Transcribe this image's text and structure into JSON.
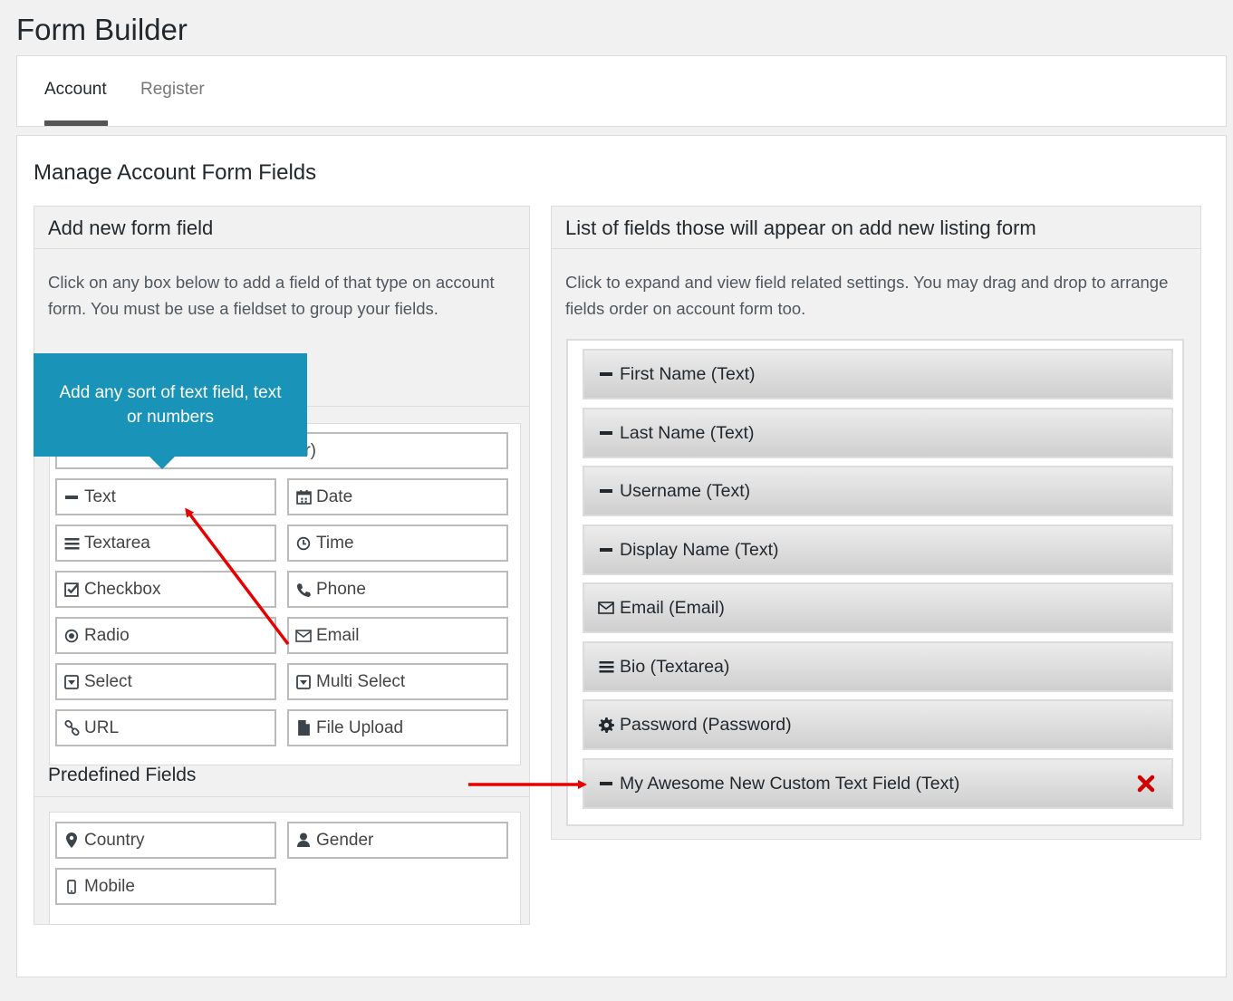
{
  "page": {
    "title": "Form Builder"
  },
  "tabs": [
    {
      "label": "Account",
      "active": true
    },
    {
      "label": "Register",
      "active": false
    }
  ],
  "section": {
    "title": "Manage Account Form Fields"
  },
  "left_panel": {
    "title": "Add new form field",
    "description": "Click on any box below to add a field of that type on account form. You must be use a fieldset to group your fields.",
    "hidden_button_partial": "r)",
    "fields": [
      {
        "label": "Text",
        "icon": "minus-icon"
      },
      {
        "label": "Date",
        "icon": "calendar-icon"
      },
      {
        "label": "Textarea",
        "icon": "bars-icon"
      },
      {
        "label": "Time",
        "icon": "clock-icon"
      },
      {
        "label": "Checkbox",
        "icon": "check-square-icon"
      },
      {
        "label": "Phone",
        "icon": "phone-icon"
      },
      {
        "label": "Radio",
        "icon": "dot-circle-icon"
      },
      {
        "label": "Email",
        "icon": "envelope-icon"
      },
      {
        "label": "Select",
        "icon": "caret-square-icon"
      },
      {
        "label": "Multi Select",
        "icon": "caret-square-icon"
      },
      {
        "label": "URL",
        "icon": "link-icon"
      },
      {
        "label": "File Upload",
        "icon": "file-icon"
      }
    ],
    "predefined_title": "Predefined Fields",
    "predefined": [
      {
        "label": "Country",
        "icon": "map-marker-icon"
      },
      {
        "label": "Gender",
        "icon": "user-icon"
      },
      {
        "label": "Mobile",
        "icon": "mobile-icon"
      }
    ]
  },
  "tooltip": {
    "text": "Add any sort of text field, text or numbers"
  },
  "right_panel": {
    "title": "List of fields those will appear on add new listing form",
    "description": "Click to expand and view field related settings. You may drag and drop to arrange fields order on account form too.",
    "items": [
      {
        "label": "First Name (Text)",
        "icon": "minus-icon"
      },
      {
        "label": "Last Name (Text)",
        "icon": "minus-icon"
      },
      {
        "label": "Username (Text)",
        "icon": "minus-icon"
      },
      {
        "label": "Display Name (Text)",
        "icon": "minus-icon"
      },
      {
        "label": "Email (Email)",
        "icon": "envelope-icon"
      },
      {
        "label": "Bio (Textarea)",
        "icon": "bars-icon"
      },
      {
        "label": "Password (Password)",
        "icon": "gear-icon"
      },
      {
        "label": "My Awesome New Custom Text Field (Text)",
        "icon": "minus-icon",
        "deletable": true
      }
    ]
  },
  "colors": {
    "tooltip": "#1a93b9",
    "annotation_arrow": "#e60000",
    "delete": "#d20000"
  }
}
